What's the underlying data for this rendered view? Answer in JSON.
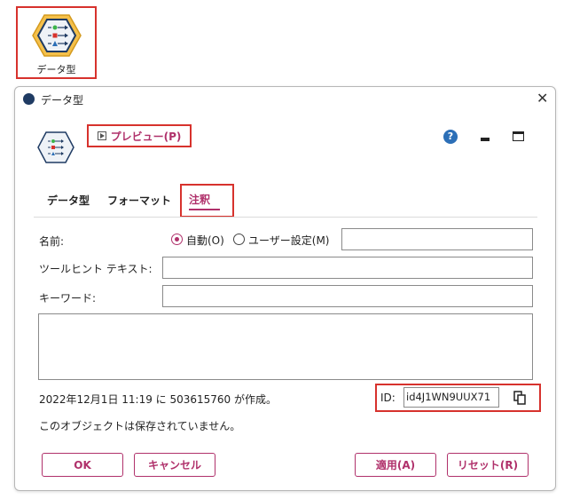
{
  "canvas_node": {
    "label": "データ型"
  },
  "dialog": {
    "title": "データ型",
    "preview_label": "プレビュー(P)",
    "help_symbol": "?",
    "tabs": [
      "データ型",
      "フォーマット",
      "注釈"
    ],
    "name_label": "名前:",
    "radio_auto": "自動(O)",
    "radio_custom": "ユーザー設定(M)",
    "tooltip_label": "ツールヒント テキスト:",
    "keywords_label": "キーワード:",
    "created_text": "2022年12月1日 11:19 に 503615760 が作成。",
    "id_label": "ID:",
    "id_value": "id4J1WN9UUX71",
    "saved_text": "このオブジェクトは保存されていません。",
    "buttons": {
      "ok": "OK",
      "cancel": "キャンセル",
      "apply": "適用(A)",
      "reset": "リセット(R)"
    }
  },
  "colors": {
    "accent": "#b0316b",
    "highlight": "#d7322d",
    "node_fill": "#f5c04a"
  }
}
